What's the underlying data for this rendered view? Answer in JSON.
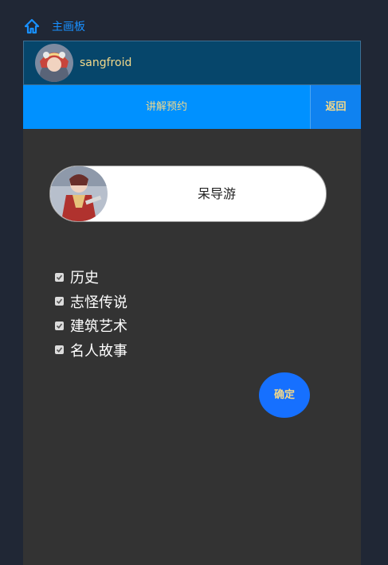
{
  "breadcrumb": {
    "icon": "home-icon",
    "label": "主画板"
  },
  "user": {
    "name": "sangfroid",
    "avatar": "anime-avatar"
  },
  "title_bar": {
    "title": "讲解预约",
    "back_label": "返回"
  },
  "guide": {
    "name": "呆导游",
    "avatar": "anime-avatar"
  },
  "topics": [
    {
      "label": "历史",
      "checked": true
    },
    {
      "label": "志怪传说",
      "checked": true
    },
    {
      "label": "建筑艺术",
      "checked": true
    },
    {
      "label": "名人故事",
      "checked": true
    }
  ],
  "confirm_label": "确定",
  "colors": {
    "background": "#202735",
    "panel": "#333333",
    "user_bar": "#06466b",
    "title_bar": "#0091ff",
    "accent_text": "#f3d98a",
    "link": "#1890ff",
    "confirm_button": "#1670ff"
  }
}
